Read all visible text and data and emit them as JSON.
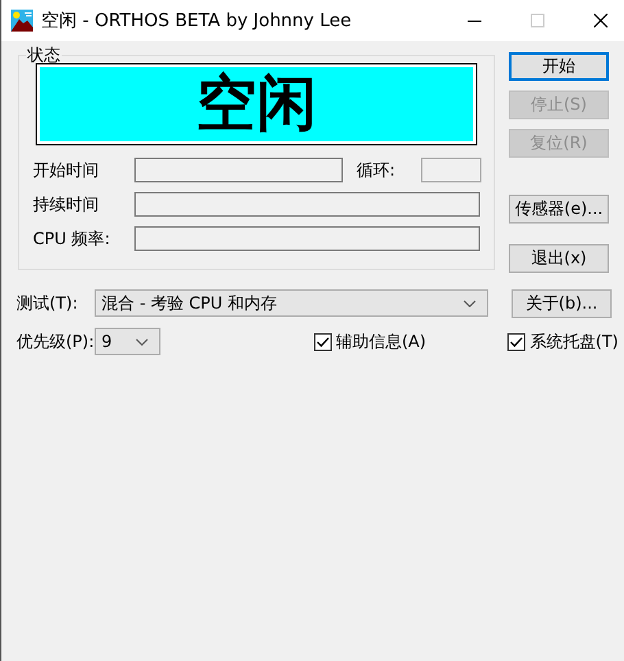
{
  "window": {
    "title": "空闲 - ORTHOS BETA by Johnny Lee"
  },
  "status": {
    "legend": "状态",
    "display": "空闲",
    "rows": [
      {
        "fields": [
          {
            "label": "开始时间"
          },
          {
            "label": "循环:"
          }
        ]
      },
      {
        "fields": [
          {
            "label": "持续时间"
          }
        ]
      },
      {
        "fields": [
          {
            "label": "CPU 频率:"
          }
        ]
      }
    ]
  },
  "buttons": [
    {
      "label": "开始",
      "disabled": false,
      "default": true
    },
    {
      "label": "停止(S)",
      "disabled": true,
      "default": false
    },
    {
      "label": "复位(R)",
      "disabled": true,
      "default": false
    },
    {
      "label": "传感器(e)...",
      "disabled": false,
      "default": false
    },
    {
      "label": "退出(x)",
      "disabled": false,
      "default": false
    }
  ],
  "test": {
    "label": "测试(T):",
    "value": "混合 - 考验 CPU 和内存",
    "button": "关于(b)..."
  },
  "priority": {
    "label": "优先级(P):",
    "value": "9"
  },
  "checkboxes": [
    {
      "label": "辅助信息(A)",
      "checked": true
    },
    {
      "label": "系统托盘(T)",
      "checked": true
    }
  ]
}
